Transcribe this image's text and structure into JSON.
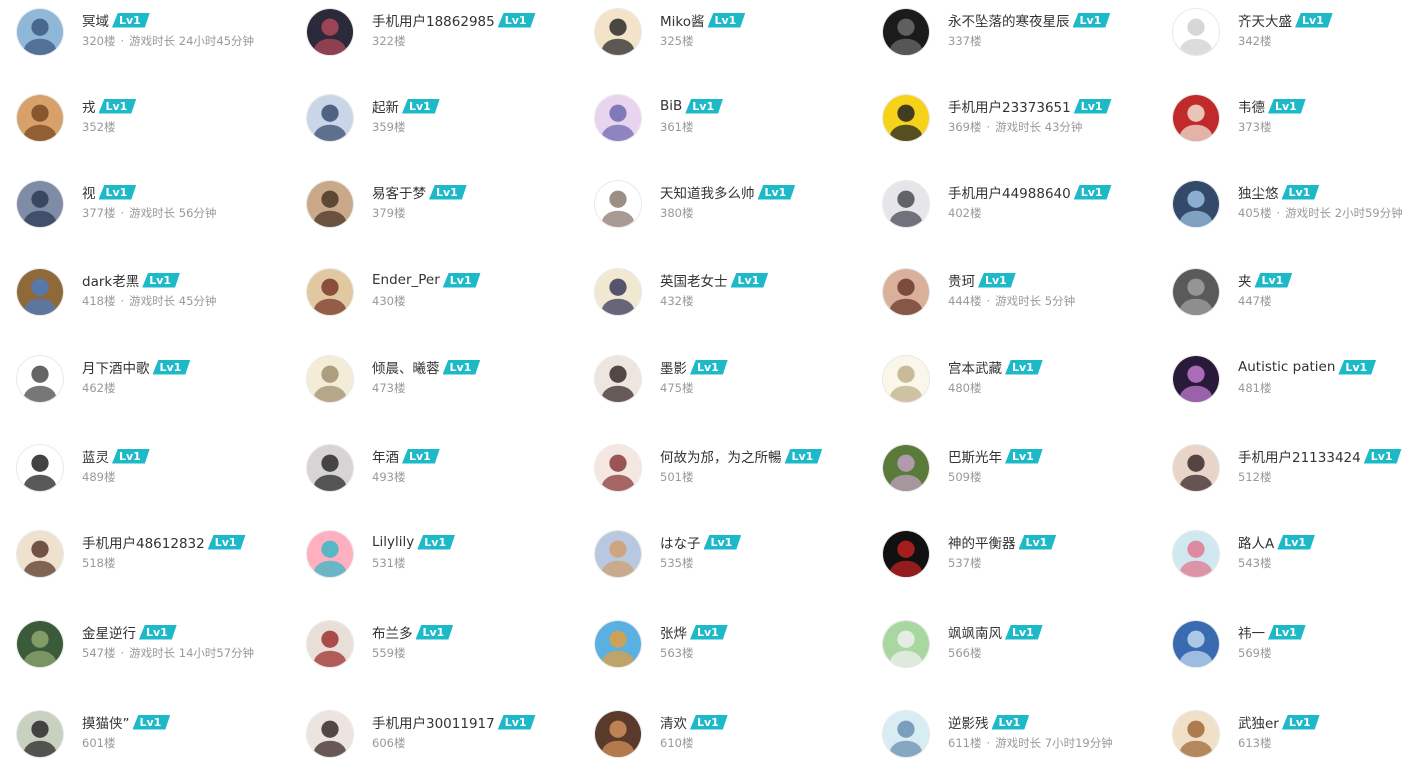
{
  "users": [
    {
      "name": "冥域",
      "floor": "320楼",
      "playtime": "游戏时长 24小时45分钟",
      "level": "Lv1"
    },
    {
      "name": "手机用户18862985",
      "floor": "322楼",
      "playtime": "",
      "level": "Lv1"
    },
    {
      "name": "Miko酱",
      "floor": "325楼",
      "playtime": "",
      "level": "Lv1"
    },
    {
      "name": "永不坠落的寒夜星辰",
      "floor": "337楼",
      "playtime": "",
      "level": "Lv1"
    },
    {
      "name": "齐天大盛",
      "floor": "342楼",
      "playtime": "",
      "level": "Lv1"
    },
    {
      "name": "戎",
      "floor": "352楼",
      "playtime": "",
      "level": "Lv1"
    },
    {
      "name": "起新",
      "floor": "359楼",
      "playtime": "",
      "level": "Lv1"
    },
    {
      "name": "BiB",
      "floor": "361楼",
      "playtime": "",
      "level": "Lv1"
    },
    {
      "name": "手机用户23373651",
      "floor": "369楼",
      "playtime": "游戏时长 43分钟",
      "level": "Lv1"
    },
    {
      "name": "韦德",
      "floor": "373楼",
      "playtime": "",
      "level": "Lv1"
    },
    {
      "name": "视",
      "floor": "377楼",
      "playtime": "游戏时长 56分钟",
      "level": "Lv1"
    },
    {
      "name": "易客于梦",
      "floor": "379楼",
      "playtime": "",
      "level": "Lv1"
    },
    {
      "name": "天知道我多么帅",
      "floor": "380楼",
      "playtime": "",
      "level": "Lv1"
    },
    {
      "name": "手机用户44988640",
      "floor": "402楼",
      "playtime": "",
      "level": "Lv1"
    },
    {
      "name": "独尘悠",
      "floor": "405楼",
      "playtime": "游戏时长 2小时59分钟",
      "level": "Lv1"
    },
    {
      "name": "dark老黑",
      "floor": "418楼",
      "playtime": "游戏时长 45分钟",
      "level": "Lv1"
    },
    {
      "name": "Ender_Per",
      "floor": "430楼",
      "playtime": "",
      "level": "Lv1"
    },
    {
      "name": "英国老女士",
      "floor": "432楼",
      "playtime": "",
      "level": "Lv1"
    },
    {
      "name": "贵珂",
      "floor": "444楼",
      "playtime": "游戏时长 5分钟",
      "level": "Lv1"
    },
    {
      "name": "夹",
      "floor": "447楼",
      "playtime": "",
      "level": "Lv1"
    },
    {
      "name": "月下酒中歌",
      "floor": "462楼",
      "playtime": "",
      "level": "Lv1"
    },
    {
      "name": "倾晨、曦蓉",
      "floor": "473楼",
      "playtime": "",
      "level": "Lv1"
    },
    {
      "name": "墨影",
      "floor": "475楼",
      "playtime": "",
      "level": "Lv1"
    },
    {
      "name": "宫本武藏",
      "floor": "480楼",
      "playtime": "",
      "level": "Lv1"
    },
    {
      "name": "Autistic patien",
      "floor": "481楼",
      "playtime": "",
      "level": "Lv1"
    },
    {
      "name": "蓝灵",
      "floor": "489楼",
      "playtime": "",
      "level": "Lv1"
    },
    {
      "name": "年酒",
      "floor": "493楼",
      "playtime": "",
      "level": "Lv1"
    },
    {
      "name": "何故为邡，为之所暢",
      "floor": "501楼",
      "playtime": "",
      "level": "Lv1"
    },
    {
      "name": "巴斯光年",
      "floor": "509楼",
      "playtime": "",
      "level": "Lv1"
    },
    {
      "name": "手机用户21133424",
      "floor": "512楼",
      "playtime": "",
      "level": "Lv1"
    },
    {
      "name": "手机用户48612832",
      "floor": "518楼",
      "playtime": "",
      "level": "Lv1"
    },
    {
      "name": "Lilylily",
      "floor": "531楼",
      "playtime": "",
      "level": "Lv1"
    },
    {
      "name": "はな子",
      "floor": "535楼",
      "playtime": "",
      "level": "Lv1"
    },
    {
      "name": "神的平衡器",
      "floor": "537楼",
      "playtime": "",
      "level": "Lv1"
    },
    {
      "name": "路人A",
      "floor": "543楼",
      "playtime": "",
      "level": "Lv1"
    },
    {
      "name": "金星逆行",
      "floor": "547楼",
      "playtime": "游戏时长 14小时57分钟",
      "level": "Lv1"
    },
    {
      "name": "布兰多",
      "floor": "559楼",
      "playtime": "",
      "level": "Lv1"
    },
    {
      "name": "张烨",
      "floor": "563楼",
      "playtime": "",
      "level": "Lv1"
    },
    {
      "name": "飒飒南风",
      "floor": "566楼",
      "playtime": "",
      "level": "Lv1"
    },
    {
      "name": "祎一",
      "floor": "569楼",
      "playtime": "",
      "level": "Lv1"
    },
    {
      "name": "摸猫侠”",
      "floor": "601楼",
      "playtime": "",
      "level": "Lv1"
    },
    {
      "name": "手机用户30011917",
      "floor": "606楼",
      "playtime": "",
      "level": "Lv1"
    },
    {
      "name": "清欢",
      "floor": "610楼",
      "playtime": "",
      "level": "Lv1"
    },
    {
      "name": "逆影残",
      "floor": "611楼",
      "playtime": "游戏时长 7小时19分钟",
      "level": "Lv1"
    },
    {
      "name": "武独er",
      "floor": "613楼",
      "playtime": "",
      "level": "Lv1"
    }
  ],
  "meta_separator": "·",
  "colors": {
    "level_badge": "#1eb9c9",
    "name": "#333333",
    "meta": "#999999"
  },
  "avatar_icons": [
    "user-avatar-icon"
  ]
}
